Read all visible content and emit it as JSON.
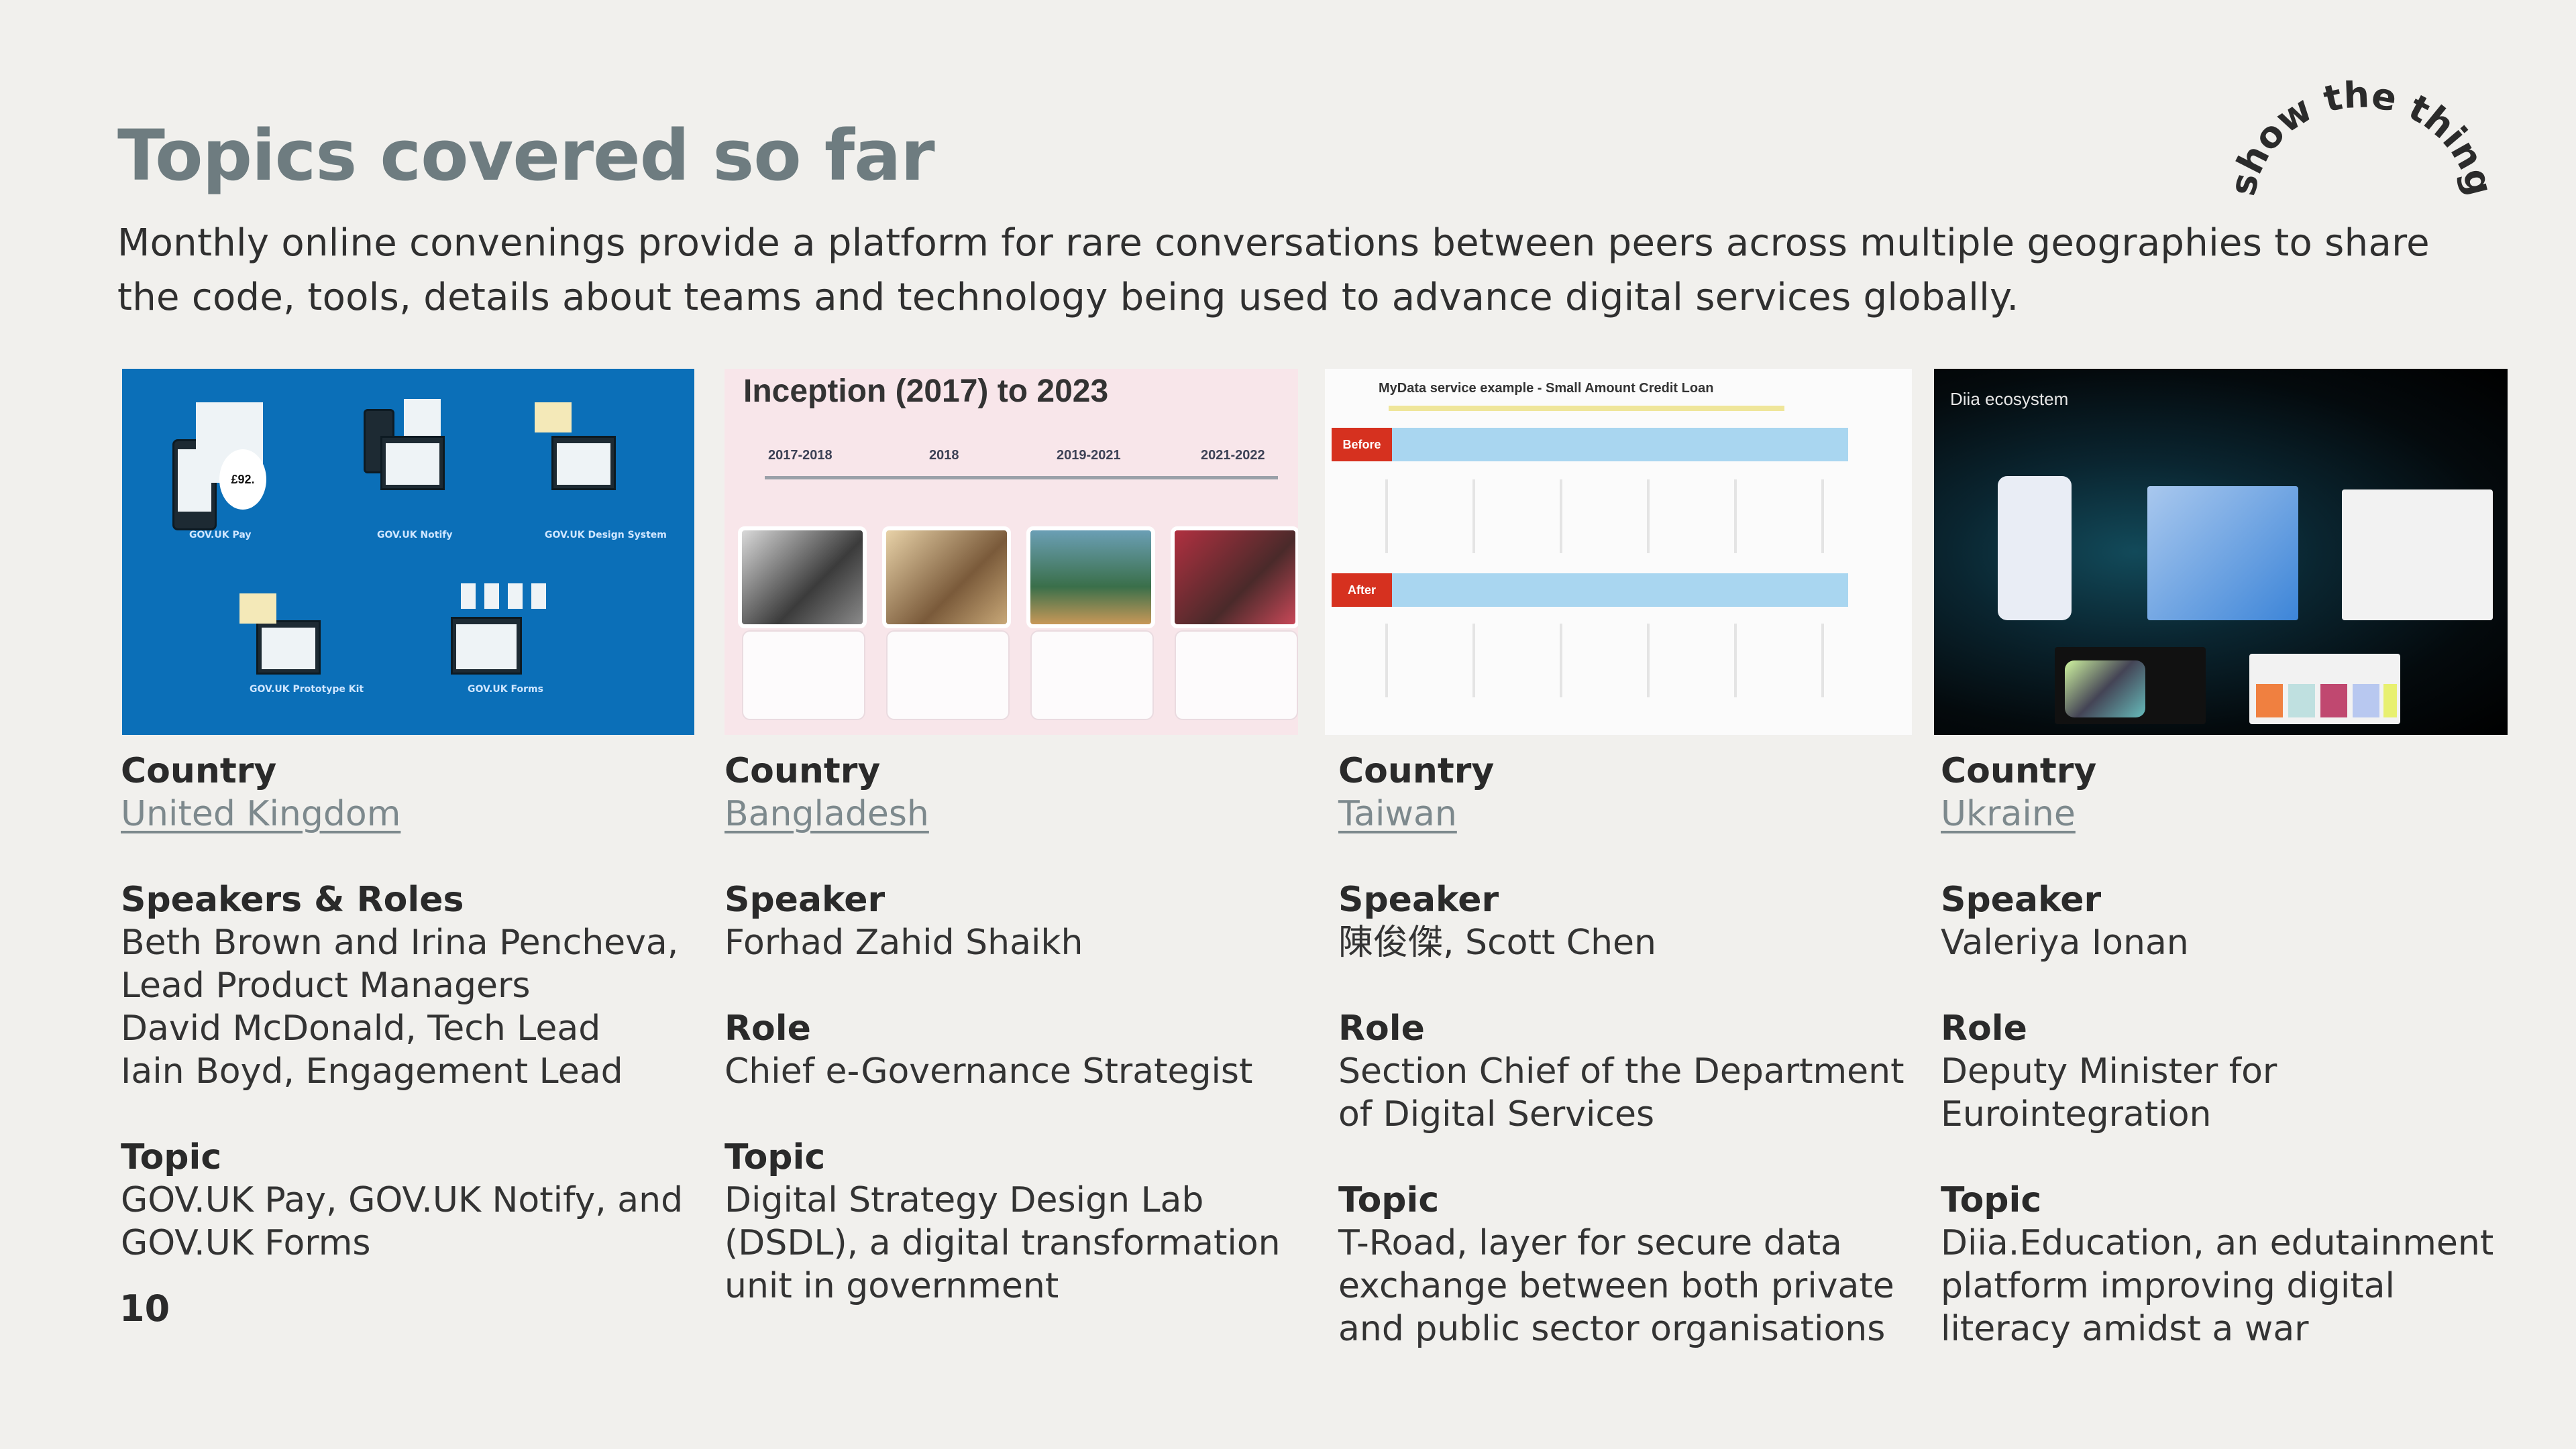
{
  "slide": {
    "title": "Topics covered so far",
    "subtitle": "Monthly online convenings provide a platform for rare conversations between peers across multiple geographies to share the code, tools, details about teams and technology being used to advance digital services globally.",
    "stamp_text": "show the thing",
    "page_number": "10"
  },
  "colors": {
    "background": "#f1f0ed",
    "title": "#6e7c80",
    "link": "#7d898d",
    "body_text": "#333333",
    "uk_thumb_blue": "#0b6fb8"
  },
  "thumbnails": [
    {
      "alt": "GOV.UK components illustration",
      "labels": [
        "GOV.UK Pay",
        "GOV.UK Notify",
        "GOV.UK Design System",
        "GOV.UK Prototype Kit",
        "GOV.UK Forms"
      ],
      "badge": "£92."
    },
    {
      "alt": "Bangladesh timeline slide",
      "heading": "Inception (2017) to 2023",
      "years": [
        "2017-2018",
        "2018",
        "2019-2021",
        "2021-2022"
      ]
    },
    {
      "alt": "Taiwan MyData service example slide",
      "heading": "MyData service example - Small Amount Credit Loan",
      "before_tag": "Before",
      "after_tag": "After"
    },
    {
      "alt": "Diia ecosystem slide",
      "heading": "Diia ecosystem"
    }
  ],
  "columns": [
    {
      "country_label": "Country",
      "country": "United Kingdom",
      "speaker_label": "Speakers & Roles",
      "speaker_lines": [
        "Beth Brown and Irina Pencheva,",
        "Lead Product Managers",
        "David McDonald, Tech Lead",
        "Iain Boyd, Engagement Lead"
      ],
      "role_label": "",
      "role_lines": [],
      "topic_label": "Topic",
      "topic_lines": [
        "GOV.UK Pay, GOV.UK Notify, and",
        "GOV.UK Forms"
      ]
    },
    {
      "country_label": "Country",
      "country": "Bangladesh",
      "speaker_label": "Speaker",
      "speaker_lines": [
        "Forhad Zahid Shaikh"
      ],
      "role_label": "Role",
      "role_lines": [
        "Chief e-Governance Strategist"
      ],
      "topic_label": "Topic",
      "topic_lines": [
        "Digital Strategy Design Lab",
        "(DSDL), a digital transformation",
        "unit in government"
      ]
    },
    {
      "country_label": "Country",
      "country": "Taiwan",
      "speaker_label": "Speaker",
      "speaker_lines": [
        "陳俊傑, Scott Chen"
      ],
      "role_label": "Role",
      "role_lines": [
        "Section Chief of the Department",
        "of Digital Services"
      ],
      "topic_label": "Topic",
      "topic_lines": [
        "T-Road, layer for secure data",
        "exchange between both private",
        "and public sector organisations"
      ]
    },
    {
      "country_label": "Country",
      "country": "Ukraine",
      "speaker_label": "Speaker",
      "speaker_lines": [
        "Valeriya Ionan"
      ],
      "role_label": "Role",
      "role_lines": [
        "Deputy Minister for",
        "Eurointegration"
      ],
      "topic_label": "Topic",
      "topic_lines": [
        "Diia.Education, an edutainment",
        "platform improving digital",
        "literacy amidst a war"
      ]
    }
  ]
}
